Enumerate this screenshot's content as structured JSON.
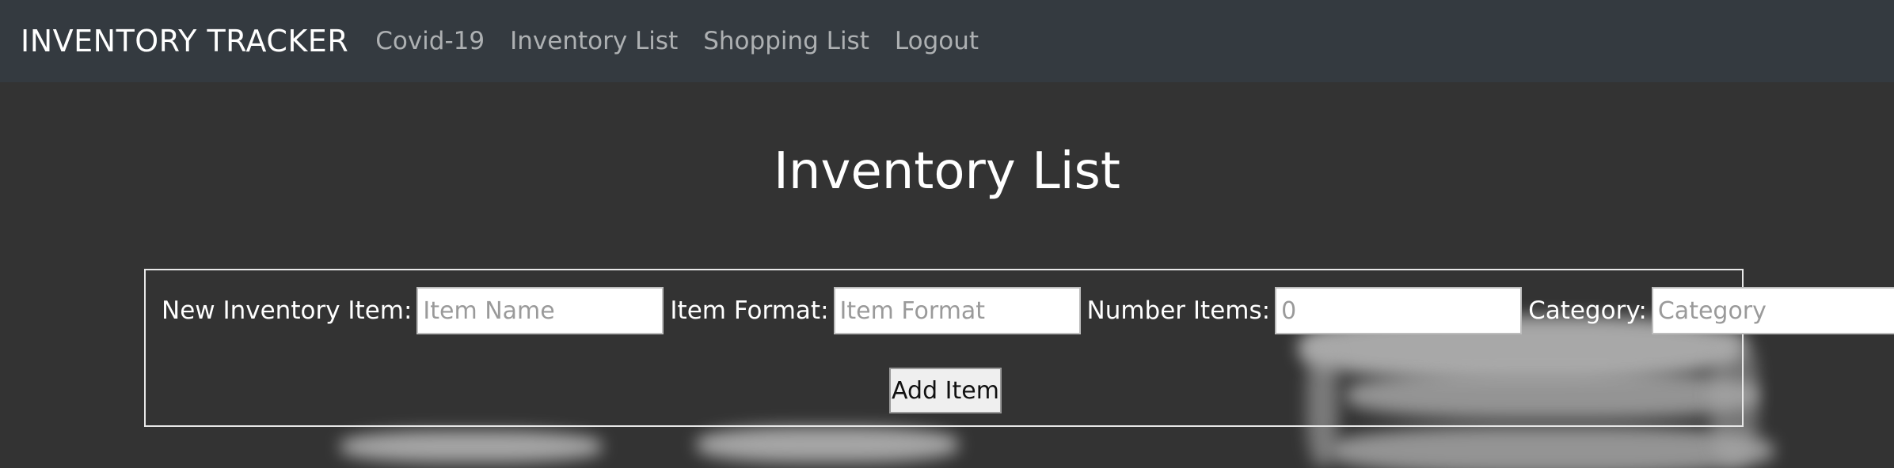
{
  "navbar": {
    "brand": "INVENTORY TRACKER",
    "links": [
      "Covid-19",
      "Inventory List",
      "Shopping List",
      "Logout"
    ]
  },
  "page": {
    "title": "Inventory List"
  },
  "form": {
    "name_label": "New Inventory Item:",
    "name_placeholder": "Item Name",
    "format_label": "Item Format:",
    "format_placeholder": "Item Format",
    "number_label": "Number Items:",
    "number_placeholder": "0",
    "category_label": "Category:",
    "category_placeholder": "Category",
    "submit_label": "Add Item"
  },
  "colors": {
    "navbar_bg": "#343a40",
    "page_bg": "#333333",
    "text": "#ffffff",
    "nav_link": "#9a9da0"
  }
}
